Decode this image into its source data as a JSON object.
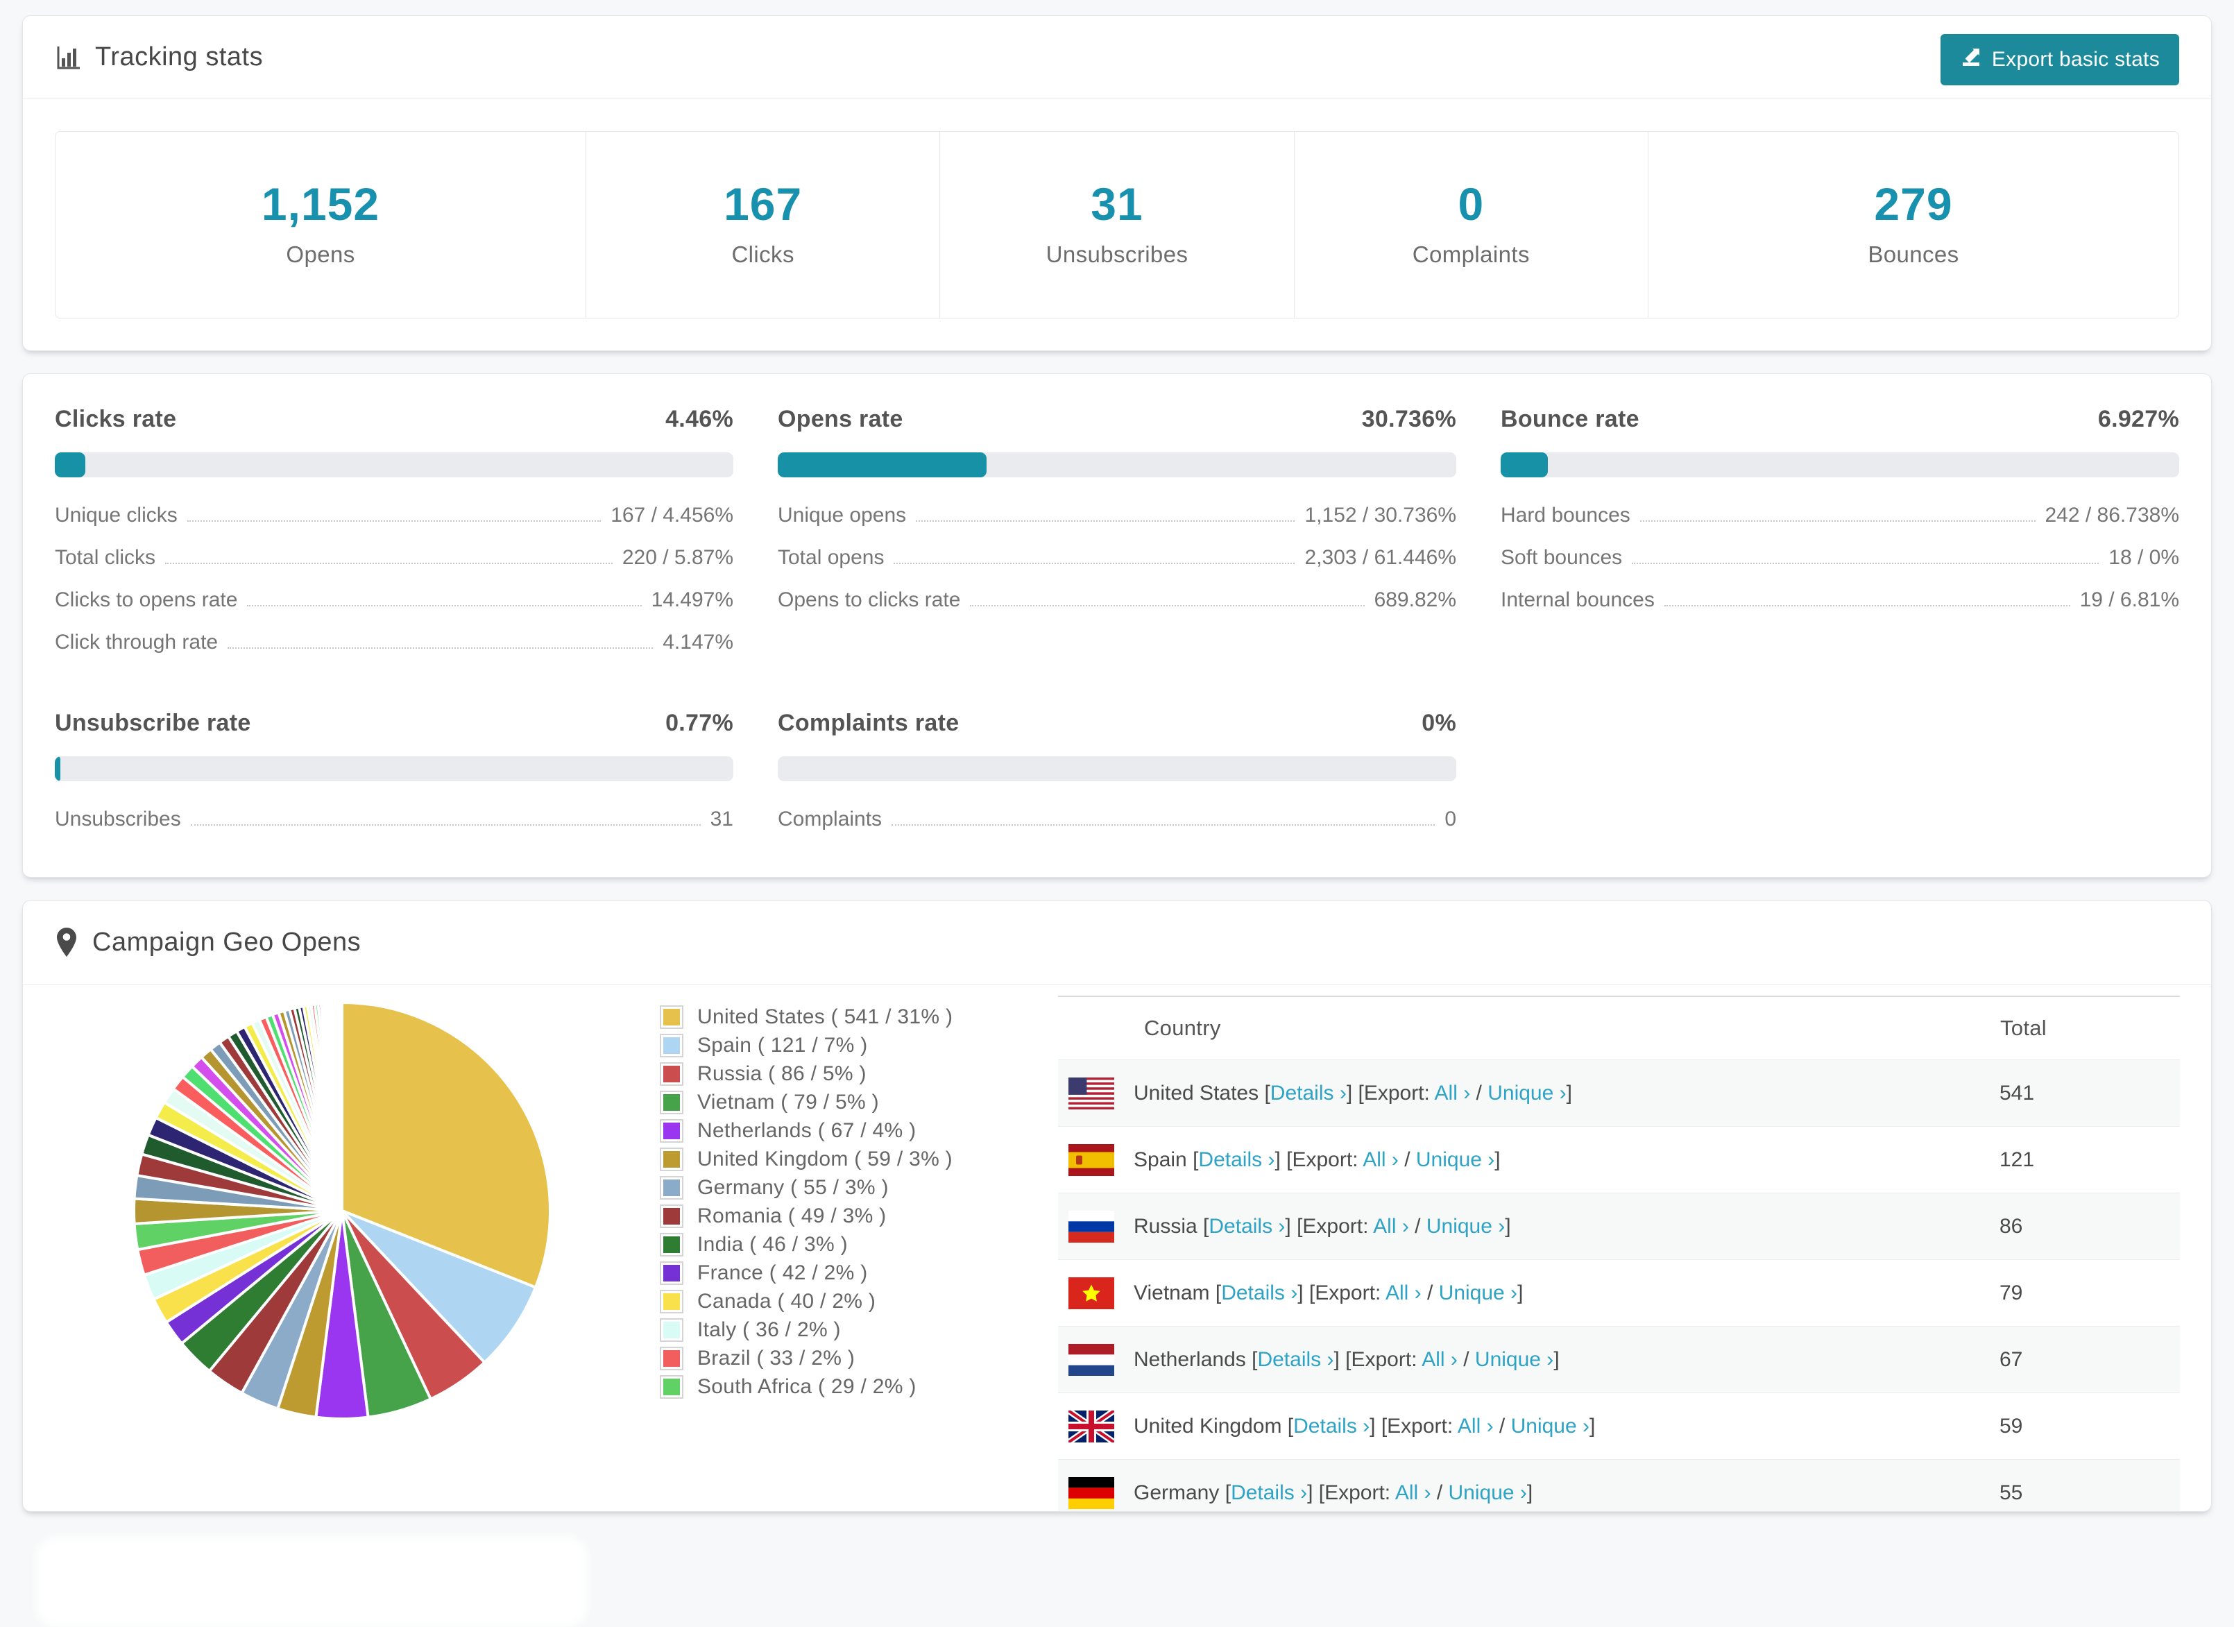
{
  "colors": {
    "accent_teal": "#1d8a9c",
    "stat_number_teal": "#1791ad",
    "bar_fill_teal": "#1791a5",
    "bar_track_gray": "#e9ebef",
    "link_teal": "#2ea3c5"
  },
  "tracking": {
    "title": "Tracking stats",
    "export_button": "Export basic stats",
    "stats": [
      {
        "value": "1,152",
        "label": "Opens"
      },
      {
        "value": "167",
        "label": "Clicks"
      },
      {
        "value": "31",
        "label": "Unsubscribes"
      },
      {
        "value": "0",
        "label": "Complaints"
      },
      {
        "value": "279",
        "label": "Bounces"
      }
    ]
  },
  "rates": {
    "blocks": [
      {
        "name": "Clicks rate",
        "value": "4.46%",
        "percent": 4.46,
        "rows": [
          {
            "label": "Unique clicks",
            "value": "167 / 4.456%"
          },
          {
            "label": "Total clicks",
            "value": "220 / 5.87%"
          },
          {
            "label": "Clicks to opens rate",
            "value": "14.497%"
          },
          {
            "label": "Click through rate",
            "value": "4.147%"
          }
        ]
      },
      {
        "name": "Opens rate",
        "value": "30.736%",
        "percent": 30.736,
        "rows": [
          {
            "label": "Unique opens",
            "value": "1,152 / 30.736%"
          },
          {
            "label": "Total opens",
            "value": "2,303 / 61.446%"
          },
          {
            "label": "Opens to clicks rate",
            "value": "689.82%"
          }
        ]
      },
      {
        "name": "Bounce rate",
        "value": "6.927%",
        "percent": 6.927,
        "rows": [
          {
            "label": "Hard bounces",
            "value": "242 / 86.738%"
          },
          {
            "label": "Soft bounces",
            "value": "18 / 0%"
          },
          {
            "label": "Internal bounces",
            "value": "19 / 6.81%"
          }
        ]
      },
      {
        "name": "Unsubscribe rate",
        "value": "0.77%",
        "percent": 0.77,
        "rows": [
          {
            "label": "Unsubscribes",
            "value": "31"
          }
        ]
      },
      {
        "name": "Complaints rate",
        "value": "0%",
        "percent": 0,
        "rows": [
          {
            "label": "Complaints",
            "value": "0"
          }
        ]
      }
    ]
  },
  "geo": {
    "title": "Campaign Geo Opens",
    "legend": [
      {
        "label": "United States ( 541 / 31% )",
        "color": "#e6c24d"
      },
      {
        "label": "Spain ( 121 / 7% )",
        "color": "#aed5f2"
      },
      {
        "label": "Russia ( 86 / 5% )",
        "color": "#cc4d4d"
      },
      {
        "label": "Vietnam ( 79 / 5% )",
        "color": "#46a349"
      },
      {
        "label": "Netherlands ( 67 / 4% )",
        "color": "#9a35f0"
      },
      {
        "label": "United Kingdom ( 59 / 3% )",
        "color": "#bd9b30"
      },
      {
        "label": "Germany ( 55 / 3% )",
        "color": "#8cabc8"
      },
      {
        "label": "Romania ( 49 / 3% )",
        "color": "#9e3a3a"
      },
      {
        "label": "India ( 46 / 3% )",
        "color": "#2e7d32"
      },
      {
        "label": "France ( 42 / 2% )",
        "color": "#7531d6"
      },
      {
        "label": "Canada ( 40 / 2% )",
        "color": "#f9e14c"
      },
      {
        "label": "Italy ( 36 / 2% )",
        "color": "#d8fcf5"
      },
      {
        "label": "Brazil ( 33 / 2% )",
        "color": "#f25e5e"
      },
      {
        "label": "South Africa ( 29 / 2% )",
        "color": "#5fd165"
      }
    ],
    "table": {
      "columns": [
        "Country",
        "Total"
      ],
      "details_label": "Details ›",
      "export_prefix": "[Export:",
      "all_label": "All ›",
      "unique_label": "Unique ›",
      "rows": [
        {
          "country": "United States",
          "flag": "us",
          "total": "541"
        },
        {
          "country": "Spain",
          "flag": "es",
          "total": "121"
        },
        {
          "country": "Russia",
          "flag": "ru",
          "total": "86"
        },
        {
          "country": "Vietnam",
          "flag": "vn",
          "total": "79"
        },
        {
          "country": "Netherlands",
          "flag": "nl",
          "total": "67"
        },
        {
          "country": "United Kingdom",
          "flag": "gb",
          "total": "59"
        },
        {
          "country": "Germany",
          "flag": "de",
          "total": "55"
        }
      ]
    }
  },
  "chart_data": {
    "type": "pie",
    "title": "Campaign Geo Opens",
    "unit": "opens",
    "labels": [
      "United States",
      "Spain",
      "Russia",
      "Vietnam",
      "Netherlands",
      "United Kingdom",
      "Germany",
      "Romania",
      "India",
      "France",
      "Canada",
      "Italy",
      "Brazil",
      "South Africa"
    ],
    "values": [
      541,
      121,
      86,
      79,
      67,
      59,
      55,
      49,
      46,
      42,
      40,
      36,
      33,
      29
    ],
    "percents": [
      31,
      7,
      5,
      5,
      4,
      3,
      3,
      3,
      3,
      2,
      2,
      2,
      2,
      2
    ],
    "colors": [
      "#e6c24d",
      "#aed5f2",
      "#cc4d4d",
      "#46a349",
      "#9a35f0",
      "#bd9b30",
      "#8cabc8",
      "#9e3a3a",
      "#2e7d32",
      "#7531d6",
      "#f9e14c",
      "#d8fcf5",
      "#f25e5e",
      "#5fd165"
    ],
    "others": {
      "note": "many small unlabeled countries",
      "percent_total": 26,
      "slice_count": 40,
      "decay_ratio": 0.93,
      "palette": [
        "#b5952f",
        "#7d9cb8",
        "#9e3a3a",
        "#1f5b2d",
        "#2d2472",
        "#f4ec4a",
        "#e4fbf4",
        "#f95d5d",
        "#4fdf70",
        "#d44ded"
      ]
    },
    "start_angle_deg": -90,
    "direction": "clockwise",
    "legend_position": "right",
    "slice_gap_stroke": "#ffffff"
  }
}
